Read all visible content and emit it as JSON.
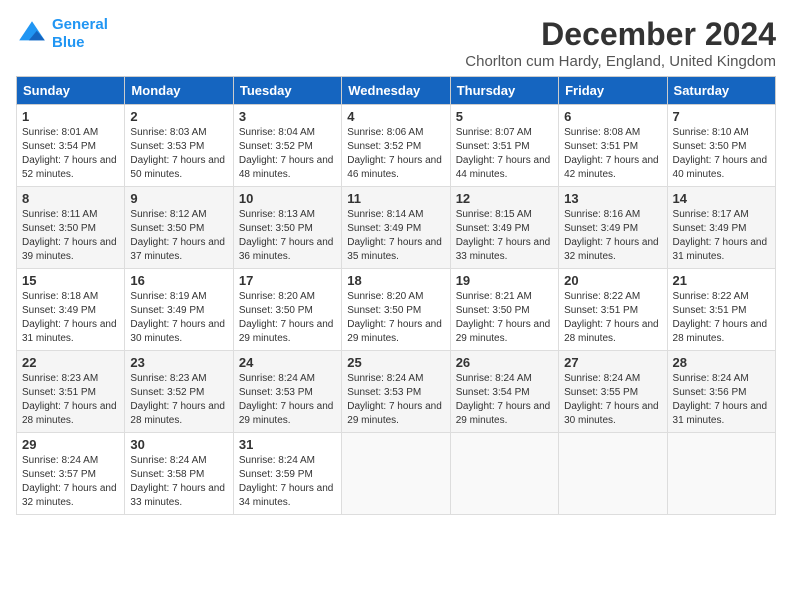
{
  "logo": {
    "line1": "General",
    "line2": "Blue"
  },
  "title": "December 2024",
  "subtitle": "Chorlton cum Hardy, England, United Kingdom",
  "days_header": [
    "Sunday",
    "Monday",
    "Tuesday",
    "Wednesday",
    "Thursday",
    "Friday",
    "Saturday"
  ],
  "weeks": [
    [
      {
        "day": "1",
        "sunrise": "8:01 AM",
        "sunset": "3:54 PM",
        "daylight": "7 hours and 52 minutes."
      },
      {
        "day": "2",
        "sunrise": "8:03 AM",
        "sunset": "3:53 PM",
        "daylight": "7 hours and 50 minutes."
      },
      {
        "day": "3",
        "sunrise": "8:04 AM",
        "sunset": "3:52 PM",
        "daylight": "7 hours and 48 minutes."
      },
      {
        "day": "4",
        "sunrise": "8:06 AM",
        "sunset": "3:52 PM",
        "daylight": "7 hours and 46 minutes."
      },
      {
        "day": "5",
        "sunrise": "8:07 AM",
        "sunset": "3:51 PM",
        "daylight": "7 hours and 44 minutes."
      },
      {
        "day": "6",
        "sunrise": "8:08 AM",
        "sunset": "3:51 PM",
        "daylight": "7 hours and 42 minutes."
      },
      {
        "day": "7",
        "sunrise": "8:10 AM",
        "sunset": "3:50 PM",
        "daylight": "7 hours and 40 minutes."
      }
    ],
    [
      {
        "day": "8",
        "sunrise": "8:11 AM",
        "sunset": "3:50 PM",
        "daylight": "7 hours and 39 minutes."
      },
      {
        "day": "9",
        "sunrise": "8:12 AM",
        "sunset": "3:50 PM",
        "daylight": "7 hours and 37 minutes."
      },
      {
        "day": "10",
        "sunrise": "8:13 AM",
        "sunset": "3:50 PM",
        "daylight": "7 hours and 36 minutes."
      },
      {
        "day": "11",
        "sunrise": "8:14 AM",
        "sunset": "3:49 PM",
        "daylight": "7 hours and 35 minutes."
      },
      {
        "day": "12",
        "sunrise": "8:15 AM",
        "sunset": "3:49 PM",
        "daylight": "7 hours and 33 minutes."
      },
      {
        "day": "13",
        "sunrise": "8:16 AM",
        "sunset": "3:49 PM",
        "daylight": "7 hours and 32 minutes."
      },
      {
        "day": "14",
        "sunrise": "8:17 AM",
        "sunset": "3:49 PM",
        "daylight": "7 hours and 31 minutes."
      }
    ],
    [
      {
        "day": "15",
        "sunrise": "8:18 AM",
        "sunset": "3:49 PM",
        "daylight": "7 hours and 31 minutes."
      },
      {
        "day": "16",
        "sunrise": "8:19 AM",
        "sunset": "3:49 PM",
        "daylight": "7 hours and 30 minutes."
      },
      {
        "day": "17",
        "sunrise": "8:20 AM",
        "sunset": "3:50 PM",
        "daylight": "7 hours and 29 minutes."
      },
      {
        "day": "18",
        "sunrise": "8:20 AM",
        "sunset": "3:50 PM",
        "daylight": "7 hours and 29 minutes."
      },
      {
        "day": "19",
        "sunrise": "8:21 AM",
        "sunset": "3:50 PM",
        "daylight": "7 hours and 29 minutes."
      },
      {
        "day": "20",
        "sunrise": "8:22 AM",
        "sunset": "3:51 PM",
        "daylight": "7 hours and 28 minutes."
      },
      {
        "day": "21",
        "sunrise": "8:22 AM",
        "sunset": "3:51 PM",
        "daylight": "7 hours and 28 minutes."
      }
    ],
    [
      {
        "day": "22",
        "sunrise": "8:23 AM",
        "sunset": "3:51 PM",
        "daylight": "7 hours and 28 minutes."
      },
      {
        "day": "23",
        "sunrise": "8:23 AM",
        "sunset": "3:52 PM",
        "daylight": "7 hours and 28 minutes."
      },
      {
        "day": "24",
        "sunrise": "8:24 AM",
        "sunset": "3:53 PM",
        "daylight": "7 hours and 29 minutes."
      },
      {
        "day": "25",
        "sunrise": "8:24 AM",
        "sunset": "3:53 PM",
        "daylight": "7 hours and 29 minutes."
      },
      {
        "day": "26",
        "sunrise": "8:24 AM",
        "sunset": "3:54 PM",
        "daylight": "7 hours and 29 minutes."
      },
      {
        "day": "27",
        "sunrise": "8:24 AM",
        "sunset": "3:55 PM",
        "daylight": "7 hours and 30 minutes."
      },
      {
        "day": "28",
        "sunrise": "8:24 AM",
        "sunset": "3:56 PM",
        "daylight": "7 hours and 31 minutes."
      }
    ],
    [
      {
        "day": "29",
        "sunrise": "8:24 AM",
        "sunset": "3:57 PM",
        "daylight": "7 hours and 32 minutes."
      },
      {
        "day": "30",
        "sunrise": "8:24 AM",
        "sunset": "3:58 PM",
        "daylight": "7 hours and 33 minutes."
      },
      {
        "day": "31",
        "sunrise": "8:24 AM",
        "sunset": "3:59 PM",
        "daylight": "7 hours and 34 minutes."
      },
      null,
      null,
      null,
      null
    ]
  ]
}
